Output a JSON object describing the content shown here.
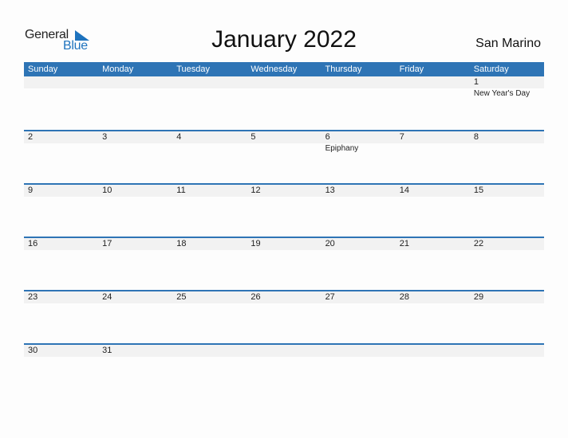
{
  "logo": {
    "general": "General",
    "blue": "Blue"
  },
  "title": "January 2022",
  "country": "San Marino",
  "weekdays": [
    "Sunday",
    "Monday",
    "Tuesday",
    "Wednesday",
    "Thursday",
    "Friday",
    "Saturday"
  ],
  "weeks": [
    [
      {
        "d": ""
      },
      {
        "d": ""
      },
      {
        "d": ""
      },
      {
        "d": ""
      },
      {
        "d": ""
      },
      {
        "d": ""
      },
      {
        "d": "1",
        "h": "New Year's Day"
      }
    ],
    [
      {
        "d": "2"
      },
      {
        "d": "3"
      },
      {
        "d": "4"
      },
      {
        "d": "5"
      },
      {
        "d": "6",
        "h": "Epiphany"
      },
      {
        "d": "7"
      },
      {
        "d": "8"
      }
    ],
    [
      {
        "d": "9"
      },
      {
        "d": "10"
      },
      {
        "d": "11"
      },
      {
        "d": "12"
      },
      {
        "d": "13"
      },
      {
        "d": "14"
      },
      {
        "d": "15"
      }
    ],
    [
      {
        "d": "16"
      },
      {
        "d": "17"
      },
      {
        "d": "18"
      },
      {
        "d": "19"
      },
      {
        "d": "20"
      },
      {
        "d": "21"
      },
      {
        "d": "22"
      }
    ],
    [
      {
        "d": "23"
      },
      {
        "d": "24"
      },
      {
        "d": "25"
      },
      {
        "d": "26"
      },
      {
        "d": "27"
      },
      {
        "d": "28"
      },
      {
        "d": "29"
      }
    ],
    [
      {
        "d": "30"
      },
      {
        "d": "31"
      },
      {
        "d": ""
      },
      {
        "d": ""
      },
      {
        "d": ""
      },
      {
        "d": ""
      },
      {
        "d": ""
      }
    ]
  ],
  "colors": {
    "accent": "#2e74b5",
    "band": "#f2f2f2"
  }
}
